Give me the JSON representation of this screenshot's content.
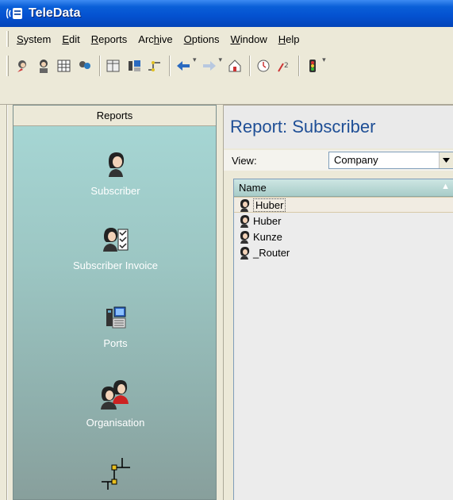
{
  "window": {
    "title": "TeleData"
  },
  "menu": {
    "items": [
      {
        "prefix": "",
        "underline": "S",
        "rest": "ystem"
      },
      {
        "prefix": "",
        "underline": "E",
        "rest": "dit"
      },
      {
        "prefix": "",
        "underline": "R",
        "rest": "eports"
      },
      {
        "prefix": "Arc",
        "underline": "h",
        "rest": "ive"
      },
      {
        "prefix": "",
        "underline": "O",
        "rest": "ptions"
      },
      {
        "prefix": "",
        "underline": "W",
        "rest": "indow"
      },
      {
        "prefix": "",
        "underline": "H",
        "rest": "elp"
      }
    ]
  },
  "sidebar": {
    "header": "Reports",
    "items": [
      {
        "label": "Subscriber"
      },
      {
        "label": "Subscriber Invoice"
      },
      {
        "label": "Ports"
      },
      {
        "label": "Organisation"
      },
      {
        "label": ""
      }
    ]
  },
  "report": {
    "title": "Report: Subscriber",
    "view_label": "View:",
    "view_value": "Company",
    "column_name": "Name",
    "rows": [
      {
        "name": "Huber"
      },
      {
        "name": "Huber"
      },
      {
        "name": "Kunze"
      },
      {
        "name": "_Router"
      }
    ]
  },
  "colors": {
    "titlebar": "#0451d0",
    "report_title": "#1f4f96",
    "sidebar_top": "#a7d8d6",
    "sidebar_bottom": "#889f9c"
  }
}
